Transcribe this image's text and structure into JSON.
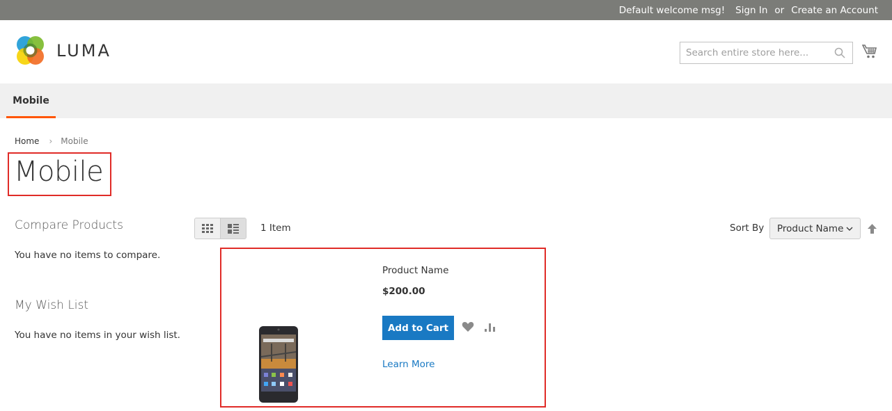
{
  "topbar": {
    "welcome": "Default welcome msg!",
    "sign_in": "Sign In",
    "or": "or",
    "create_account": "Create an Account"
  },
  "header": {
    "logo_text": "LUMA",
    "search_placeholder": "Search entire store here...",
    "search_value": ""
  },
  "nav": {
    "items": [
      {
        "label": "Mobile",
        "active": true
      }
    ]
  },
  "breadcrumb": {
    "items": [
      "Home",
      "Mobile"
    ],
    "separator": "›"
  },
  "page": {
    "title": "Mobile"
  },
  "sidebar": {
    "compare": {
      "title": "Compare Products",
      "empty_text": "You have no items to compare."
    },
    "wishlist": {
      "title": "My Wish List",
      "empty_text": "You have no items in your wish list."
    }
  },
  "toolbar": {
    "modes": [
      "grid",
      "list"
    ],
    "active_mode": "list",
    "amount": "1 Item",
    "sort_label": "Sort By",
    "sort_selected": "Product Name",
    "sort_direction": "ascending"
  },
  "products": [
    {
      "name": "Product Name",
      "price": "$200.00",
      "add_to_cart": "Add to Cart",
      "learn_more": "Learn More"
    }
  ],
  "colors": {
    "topbar_bg": "#7b7c78",
    "nav_bg": "#f0f0f0",
    "nav_active": "#ff5501",
    "primary": "#1979c3",
    "highlight": "#e02b27"
  }
}
